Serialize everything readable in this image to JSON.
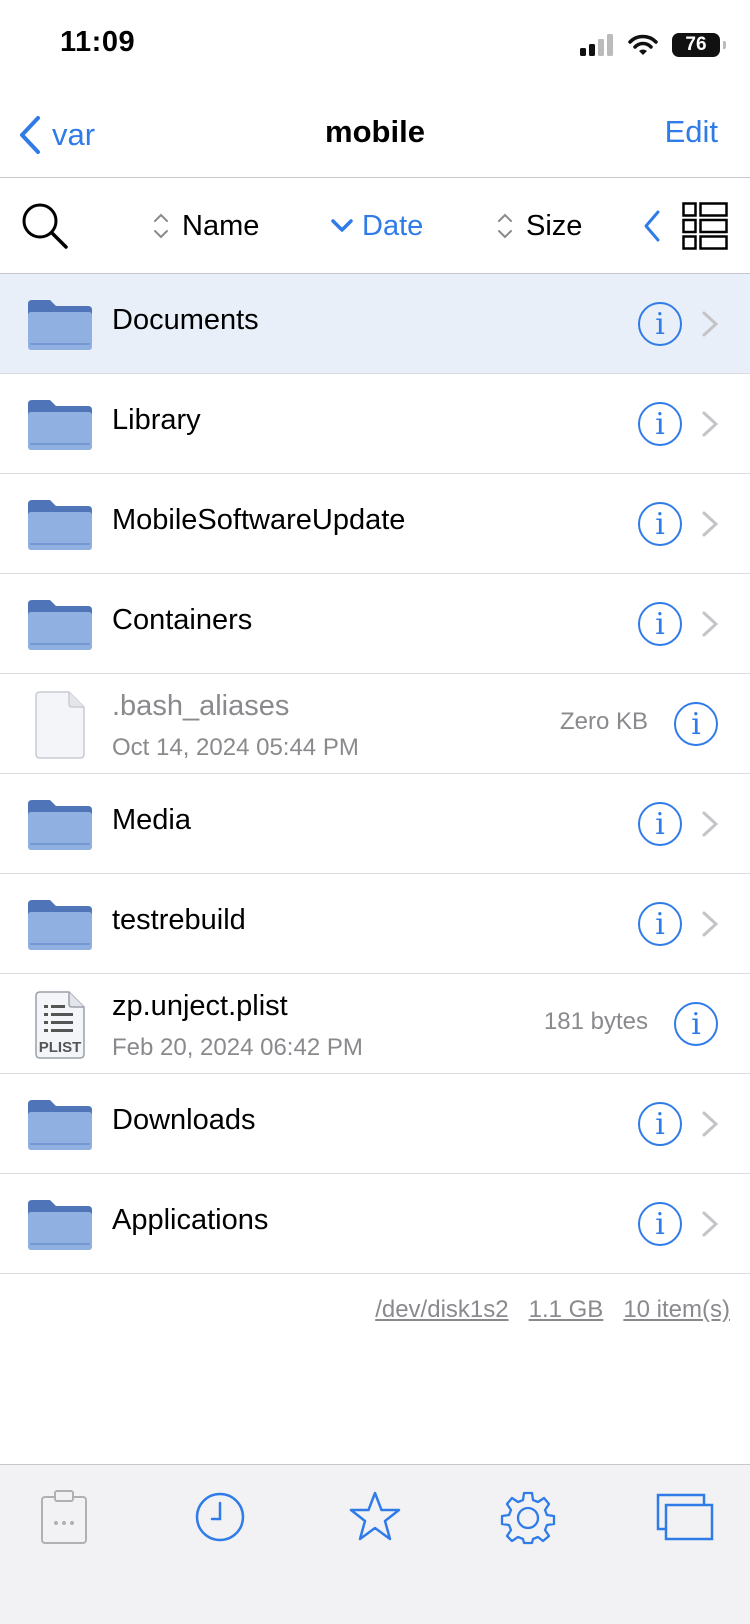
{
  "status": {
    "time": "11:09",
    "battery": "76"
  },
  "nav": {
    "back_label": "var",
    "title": "mobile",
    "edit_label": "Edit"
  },
  "toolbar": {
    "sort_name": "Name",
    "sort_date": "Date",
    "sort_size": "Size",
    "active_sort": "Date"
  },
  "files": [
    {
      "name": "Documents",
      "type": "folder",
      "selected": true
    },
    {
      "name": "Library",
      "type": "folder"
    },
    {
      "name": "MobileSoftwareUpdate",
      "type": "folder"
    },
    {
      "name": "Containers",
      "type": "folder"
    },
    {
      "name": ".bash_aliases",
      "type": "file",
      "date": "Oct 14, 2024 05:44 PM",
      "size": "Zero KB",
      "icon": "blank-document-icon"
    },
    {
      "name": "Media",
      "type": "folder"
    },
    {
      "name": "testrebuild",
      "type": "folder"
    },
    {
      "name": "zp.unject.plist",
      "type": "file",
      "date": "Feb 20, 2024 06:42 PM",
      "size": "181 bytes",
      "icon": "plist-document-icon",
      "icon_label": "PLIST"
    },
    {
      "name": "Downloads",
      "type": "folder"
    },
    {
      "name": "Applications",
      "type": "folder"
    }
  ],
  "footer": {
    "disk": "/dev/disk1s2",
    "free": "1.1 GB",
    "count": "10 item(s)"
  },
  "tabs": [
    "clipboard-icon",
    "recent-clock-icon",
    "favorites-star-icon",
    "settings-gear-icon",
    "windows-icon"
  ],
  "colors": {
    "accent": "#2f7be8",
    "folder": "#8fb0e0",
    "folder_tab": "#4f74b8",
    "selected_row": "#e8eff9"
  }
}
